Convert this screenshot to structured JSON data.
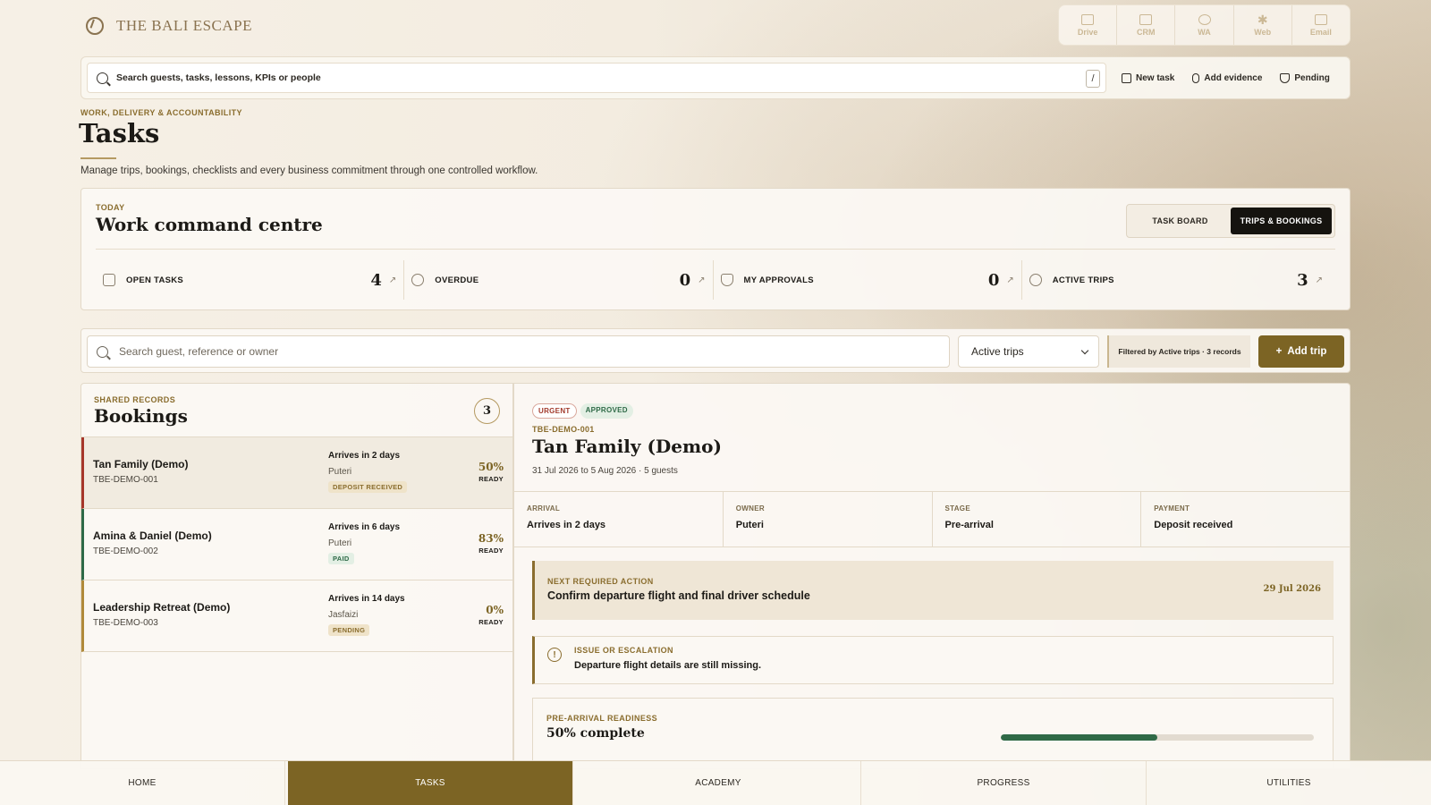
{
  "brand": {
    "name": "THE BALI ESCAPE"
  },
  "apps": [
    {
      "label": "Drive",
      "icon": "folder-icon"
    },
    {
      "label": "CRM",
      "icon": "table-icon"
    },
    {
      "label": "WA",
      "icon": "chat-icon"
    },
    {
      "label": "Web",
      "icon": "asterisk-icon"
    },
    {
      "label": "Email",
      "icon": "mail-icon"
    }
  ],
  "search": {
    "placeholder": "Search guests, tasks, lessons, KPIs or people",
    "shortcut": "/"
  },
  "quick_actions": {
    "new_task": "New task",
    "add_evidence": "Add evidence",
    "pending": "Pending"
  },
  "page": {
    "eyebrow": "WORK, DELIVERY & ACCOUNTABILITY",
    "title": "Tasks",
    "subtitle": "Manage trips, bookings, checklists and every business commitment through one controlled workflow."
  },
  "command": {
    "eyebrow": "TODAY",
    "title": "Work command centre",
    "toggle": {
      "board": "TASK BOARD",
      "trips": "TRIPS & BOOKINGS"
    },
    "kpis": [
      {
        "label": "OPEN TASKS",
        "value": "4",
        "icon": "checklist-icon"
      },
      {
        "label": "OVERDUE",
        "value": "0",
        "icon": "clock-icon"
      },
      {
        "label": "MY APPROVALS",
        "value": "0",
        "icon": "shield-check-icon"
      },
      {
        "label": "ACTIVE TRIPS",
        "value": "3",
        "icon": "person-pin-icon"
      }
    ]
  },
  "filters": {
    "search_placeholder": "Search guest, reference or owner",
    "select_value": "Active trips",
    "note": "Filtered by Active trips · 3 records",
    "add_label": "Add trip"
  },
  "bookings": {
    "eyebrow": "SHARED RECORDS",
    "title": "Bookings",
    "count": "3",
    "items": [
      {
        "name": "Tan Family (Demo)",
        "ref": "TBE-DEMO-001",
        "arrive": "Arrives in 2 days",
        "owner": "Puteri",
        "tag": "DEPOSIT RECEIVED",
        "pct": "50%",
        "ready": "READY"
      },
      {
        "name": "Amina & Daniel (Demo)",
        "ref": "TBE-DEMO-002",
        "arrive": "Arrives in 6 days",
        "owner": "Puteri",
        "tag": "PAID",
        "pct": "83%",
        "ready": "READY"
      },
      {
        "name": "Leadership Retreat (Demo)",
        "ref": "TBE-DEMO-003",
        "arrive": "Arrives in 14 days",
        "owner": "Jasfaizi",
        "tag": "PENDING",
        "pct": "0%",
        "ready": "READY"
      }
    ],
    "colors": {
      "urgent": "#a6362a",
      "ok": "#2f6a47",
      "pending": "#b08a3a"
    }
  },
  "detail": {
    "badges": {
      "urgent": "URGENT",
      "approved": "APPROVED"
    },
    "ref": "TBE-DEMO-001",
    "title": "Tan Family (Demo)",
    "dates": "31 Jul 2026 to 5 Aug 2026 · 5 guests",
    "facts": [
      {
        "label": "ARRIVAL",
        "value": "Arrives in 2 days"
      },
      {
        "label": "OWNER",
        "value": "Puteri"
      },
      {
        "label": "STAGE",
        "value": "Pre-arrival"
      },
      {
        "label": "PAYMENT",
        "value": "Deposit received"
      }
    ],
    "next_action": {
      "eyebrow": "NEXT REQUIRED ACTION",
      "text": "Confirm departure flight and final driver schedule",
      "date": "29 Jul 2026"
    },
    "issue": {
      "eyebrow": "ISSUE OR ESCALATION",
      "text": "Departure flight details are still missing."
    },
    "readiness": {
      "eyebrow": "PRE-ARRIVAL READINESS",
      "value": "50% complete",
      "percent": 50
    }
  },
  "nav": [
    "HOME",
    "TASKS",
    "ACADEMY",
    "PROGRESS",
    "UTILITIES"
  ]
}
